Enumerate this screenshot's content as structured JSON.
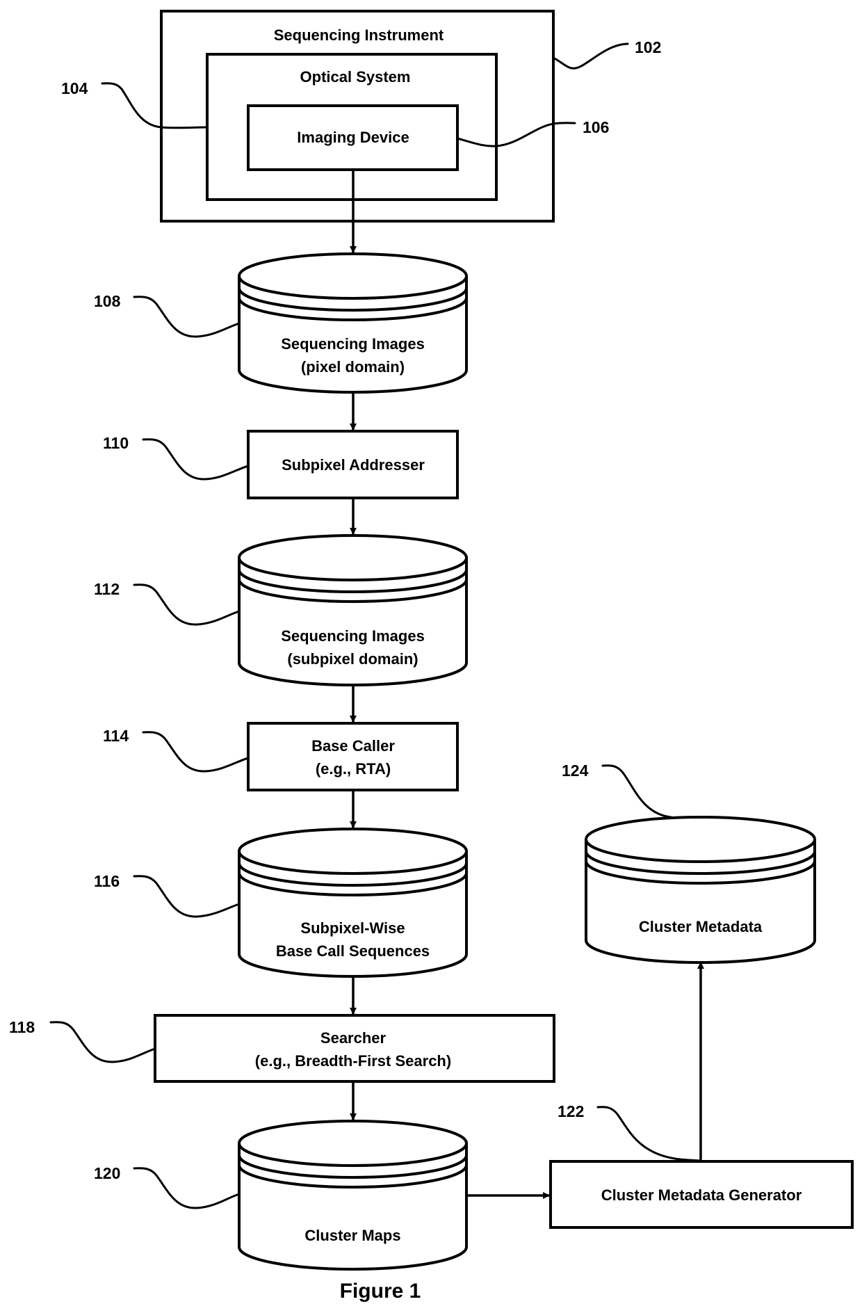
{
  "figure": {
    "caption": "Figure 1"
  },
  "nodes": {
    "sequencing_instrument": {
      "ref": "102",
      "label": "Sequencing Instrument"
    },
    "optical_system": {
      "ref": "104",
      "label": "Optical System"
    },
    "imaging_device": {
      "ref": "106",
      "label": "Imaging Device"
    },
    "sequencing_images_pixel": {
      "ref": "108",
      "lines": [
        "Sequencing Images",
        "(pixel domain)"
      ]
    },
    "subpixel_addresser": {
      "ref": "110",
      "label": "Subpixel Addresser"
    },
    "sequencing_images_subpixel": {
      "ref": "112",
      "lines": [
        "Sequencing Images",
        "(subpixel domain)"
      ]
    },
    "base_caller": {
      "ref": "114",
      "lines": [
        "Base Caller",
        "(e.g., RTA)"
      ]
    },
    "base_call_sequences": {
      "ref": "116",
      "lines": [
        "Subpixel-Wise",
        "Base Call Sequences"
      ]
    },
    "searcher": {
      "ref": "118",
      "lines": [
        "Searcher",
        "(e.g., Breadth-First Search)"
      ]
    },
    "cluster_maps": {
      "ref": "120",
      "label": "Cluster Maps"
    },
    "cluster_metadata_generator": {
      "ref": "122",
      "label": "Cluster Metadata Generator"
    },
    "cluster_metadata": {
      "ref": "124",
      "label": "Cluster Metadata"
    }
  },
  "edges": [
    {
      "from": "imaging_device",
      "to": "sequencing_images_pixel"
    },
    {
      "from": "sequencing_images_pixel",
      "to": "subpixel_addresser"
    },
    {
      "from": "subpixel_addresser",
      "to": "sequencing_images_subpixel"
    },
    {
      "from": "sequencing_images_subpixel",
      "to": "base_caller"
    },
    {
      "from": "base_caller",
      "to": "base_call_sequences"
    },
    {
      "from": "base_call_sequences",
      "to": "searcher"
    },
    {
      "from": "searcher",
      "to": "cluster_maps"
    },
    {
      "from": "cluster_maps",
      "to": "cluster_metadata_generator"
    },
    {
      "from": "cluster_metadata_generator",
      "to": "cluster_metadata"
    }
  ]
}
